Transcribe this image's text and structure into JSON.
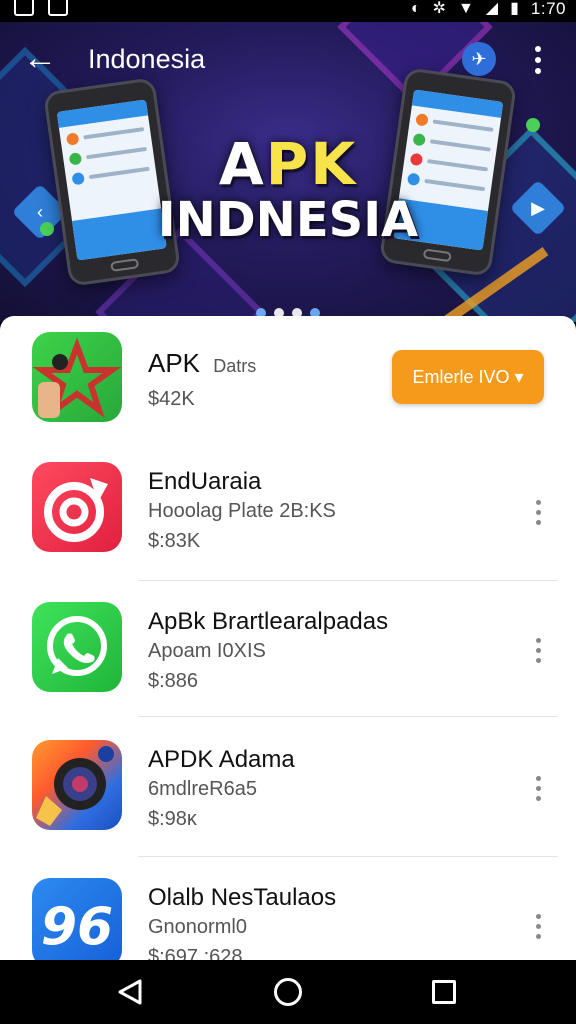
{
  "status_bar": {
    "time": "1:70"
  },
  "header": {
    "title": "Indonesia",
    "banner_line1_a": "A",
    "banner_line1_b": "PK",
    "banner_line2": "INDNESIA"
  },
  "featured": {
    "name": "APK",
    "tag": "Datrs",
    "price": "$42K",
    "install_label": "Emlerle IVO ▾"
  },
  "apps": [
    {
      "name": "EndUaraia",
      "sub": "Hooolag Plate 2B:KS",
      "price": "$:83K"
    },
    {
      "name": "ApBk Brartlearalpadas",
      "sub": "Apoam I0XIS",
      "price": "$:886"
    },
    {
      "name": "APDK Adama",
      "sub": "6mdlreR6a5",
      "price": "$:98ĸ"
    },
    {
      "name": "Olalb NesTaulaos",
      "sub": "Gnonorml0",
      "price": "$:697 :628"
    }
  ],
  "colors": {
    "accent": "#f59a1b",
    "brand_blue": "#2f8ee6"
  }
}
